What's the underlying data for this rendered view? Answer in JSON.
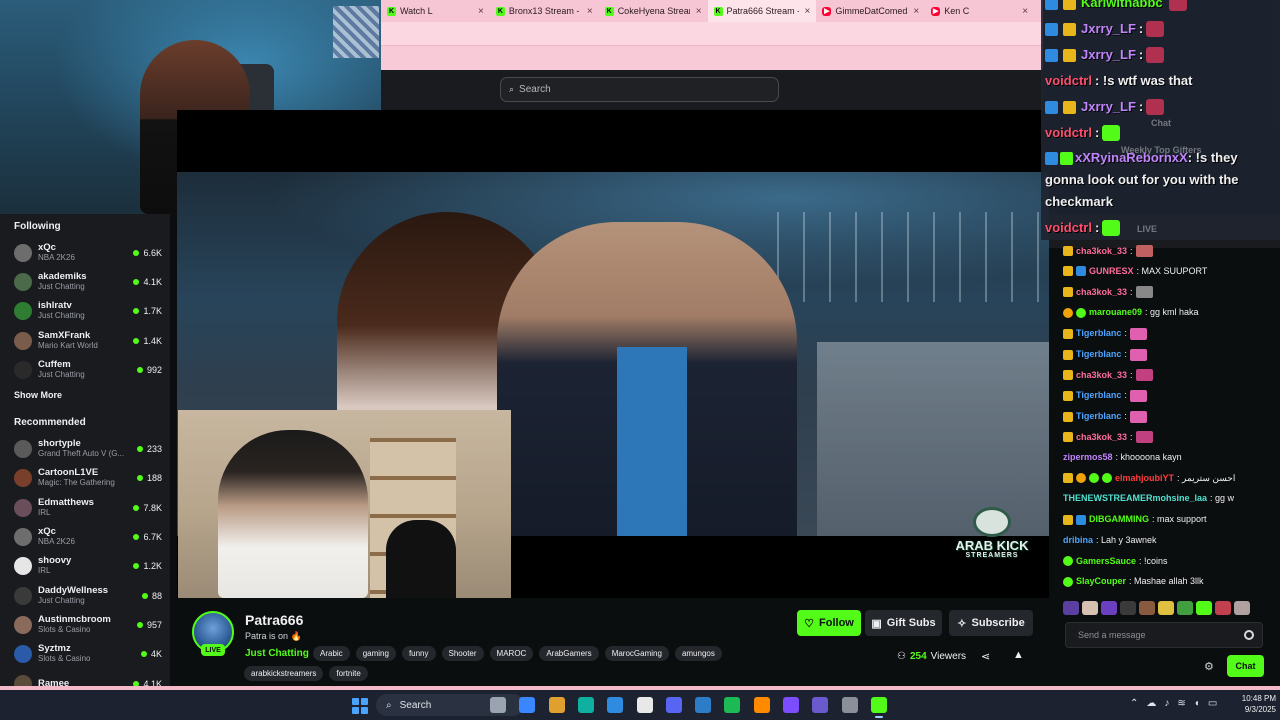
{
  "browser": {
    "tabs": [
      {
        "label": "Watch L",
        "favicon": "K",
        "type": "kick"
      },
      {
        "label": "Bronx13 Stream - Watch Li",
        "favicon": "K",
        "type": "kick"
      },
      {
        "label": "CokeHyena Stream - Watc",
        "favicon": "K",
        "type": "kick"
      },
      {
        "label": "Patra666 Stream - Watch L",
        "favicon": "K",
        "type": "kick",
        "active": true
      },
      {
        "label": "GimmeDatComedy - crazy",
        "favicon": "▶",
        "type": "youtube"
      },
      {
        "label": "Ken C",
        "favicon": "▶",
        "type": "youtube"
      }
    ]
  },
  "top_nav": {
    "search_placeholder": "Search",
    "search_icon": "search-icon"
  },
  "sidebar": {
    "following_header": "Following",
    "following": [
      {
        "name": "xQc",
        "category": "NBA 2K26",
        "viewers": "6.6K",
        "avatar_color": "#6d6d6d"
      },
      {
        "name": "akademiks",
        "category": "Just Chatting",
        "viewers": "4.1K",
        "avatar_color": "#4a6a4a"
      },
      {
        "name": "ishlratv",
        "category": "Just Chatting",
        "viewers": "1.7K",
        "avatar_color": "#2e7d32"
      },
      {
        "name": "SamXFrank",
        "category": "Mario Kart World",
        "viewers": "1.4K",
        "avatar_color": "#7a5c4d"
      },
      {
        "name": "Cuffem",
        "category": "Just Chatting",
        "viewers": "992",
        "avatar_color": "#2a2a2a"
      }
    ],
    "show_more": "Show More",
    "recommended_header": "Recommended",
    "recommended": [
      {
        "name": "shortyple",
        "category": "Grand Theft Auto V (G...",
        "viewers": "233",
        "avatar_color": "#5a5a5a"
      },
      {
        "name": "CartoonL1VE",
        "category": "Magic: The Gathering",
        "viewers": "188",
        "avatar_color": "#7a3f2a"
      },
      {
        "name": "Edmatthews",
        "category": "IRL",
        "viewers": "7.8K",
        "avatar_color": "#6a4f5a"
      },
      {
        "name": "xQc",
        "category": "NBA 2K26",
        "viewers": "6.7K",
        "avatar_color": "#6d6d6d"
      },
      {
        "name": "shoovy",
        "category": "IRL",
        "viewers": "1.2K",
        "avatar_color": "#e6e6e6"
      },
      {
        "name": "DaddyWellness",
        "category": "Just Chatting",
        "viewers": "88",
        "avatar_color": "#3a3a3a"
      },
      {
        "name": "Austinmcbroom",
        "category": "Slots & Casino",
        "viewers": "957",
        "avatar_color": "#8a6a5a"
      },
      {
        "name": "Syztmz",
        "category": "Slots & Casino",
        "viewers": "4K",
        "avatar_color": "#2a5aa8"
      },
      {
        "name": "Ramee",
        "category": "",
        "viewers": "4.1K",
        "avatar_color": "#5a4a3a"
      }
    ]
  },
  "video": {
    "watermark_title": "ARAB KICK",
    "watermark_subtitle": "STREAMERS"
  },
  "stream_info": {
    "channel_name": "Patra666",
    "title": "Patra is on 🔥",
    "live_badge": "LIVE",
    "category": "Just Chatting",
    "tags_row1": [
      "Arabic",
      "gaming",
      "funny",
      "Shooter",
      "MAROC",
      "ArabGamers",
      "MarocGaming",
      "amungos"
    ],
    "tags_row2": [
      "arabkickstreamers",
      "fortnite"
    ],
    "follow_label": "Follow",
    "gift_label": "Gift Subs",
    "subscribe_label": "Subscribe",
    "viewer_count": "254",
    "viewers_label": "Viewers"
  },
  "overlay_chat": {
    "lines": [
      {
        "user": "Karlwithabbc",
        "color": "#53fc18",
        "text": ""
      },
      {
        "user": "Jxrry_LF",
        "color": "#c084fc",
        "text": ":"
      },
      {
        "user": "Jxrry_LF",
        "color": "#c084fc",
        "text": ":"
      },
      {
        "user": "voidctrl",
        "color": "#ff4d6d",
        "text": ": !s wtf was that"
      },
      {
        "user": "Jxrry_LF",
        "color": "#c084fc",
        "text": ":"
      },
      {
        "user": "voidctrl",
        "color": "#ff4d6d",
        "text": ":"
      }
    ],
    "wrap_user": "xXRyinaRebornxX",
    "wrap_text": ": !s they gonna look out for you with the checkmark",
    "last_user": "voidctrl",
    "last_text": ":",
    "faint_chat": "Chat",
    "faint_gifters": "Weekly Top Gifters",
    "faint_live": "LIVE"
  },
  "chat": {
    "messages": [
      {
        "user": "cha3kok_33",
        "color": "#ff6b9a",
        "text": ":",
        "badges": [
          "crown"
        ],
        "emote": "#c06060"
      },
      {
        "user": "GUNRESX",
        "color": "#ff6b9a",
        "text": ": MAX SUUPORT",
        "badges": [
          "crown",
          "sub"
        ]
      },
      {
        "user": "cha3kok_33",
        "color": "#ff6b9a",
        "text": ":",
        "badges": [
          "crown"
        ],
        "emote": "#888888"
      },
      {
        "user": "marouane09",
        "color": "#53fc18",
        "text": ": gg kml haka",
        "badges": [
          "circle",
          "green"
        ]
      },
      {
        "user": "Tigerblanc",
        "color": "#4da3ff",
        "text": ":",
        "badges": [
          "crown"
        ],
        "emote": "#e060b0"
      },
      {
        "user": "Tigerblanc",
        "color": "#4da3ff",
        "text": ":",
        "badges": [
          "crown"
        ],
        "emote": "#e060b0"
      },
      {
        "user": "cha3kok_33",
        "color": "#ff6b9a",
        "text": ":",
        "badges": [
          "crown"
        ],
        "emote": "#c04080"
      },
      {
        "user": "Tigerblanc",
        "color": "#4da3ff",
        "text": ":",
        "badges": [
          "crown"
        ],
        "emote": "#e060b0"
      },
      {
        "user": "Tigerblanc",
        "color": "#4da3ff",
        "text": ":",
        "badges": [
          "crown"
        ],
        "emote": "#e060b0"
      },
      {
        "user": "cha3kok_33",
        "color": "#ff6b9a",
        "text": ":",
        "badges": [
          "crown"
        ],
        "emote": "#c04080"
      },
      {
        "user": "zipermos58",
        "color": "#c084fc",
        "text": ": khoooona kayn",
        "badges": []
      },
      {
        "user": "elmahjoubiYT",
        "color": "#ff3b3b",
        "text": ": احسن ستريمر",
        "badges": [
          "crown",
          "circle",
          "green",
          "green"
        ]
      },
      {
        "user": "THENEWSTREAMERmohsine_laa",
        "color": "#53e0d0",
        "text": ": gg w",
        "badges": []
      },
      {
        "user": "DIBGAMMING",
        "color": "#53fc18",
        "text": ": max support",
        "badges": [
          "crown",
          "sub"
        ]
      },
      {
        "user": "dribina",
        "color": "#4da3ff",
        "text": ": Lah y 3awnek",
        "badges": []
      },
      {
        "user": "GamersSauce",
        "color": "#53fc18",
        "text": ": !coins",
        "badges": [
          "green"
        ]
      },
      {
        "user": "SlayCouper",
        "color": "#53fc18",
        "text": ": Mashae allah 3llk",
        "badges": [
          "green"
        ]
      }
    ],
    "emote_bar_colors": [
      "#5a3fa0",
      "#d8c0b0",
      "#6a40c0",
      "#3a3a3a",
      "#8a5a40",
      "#e0c040",
      "#40a040",
      "#53fc18",
      "#c04050",
      "#b0a0a0"
    ],
    "input_placeholder": "Send a message",
    "chat_button": "Chat"
  },
  "taskbar": {
    "search_label": "Search",
    "time": "10:48 PM",
    "date": "9/3/2025",
    "icon_colors": [
      "#9aa3b0",
      "#3a86ff",
      "#e0a030",
      "#0fb0a0",
      "#2f8be0",
      "#e8e8e8",
      "#5865f2",
      "#2c7cc8",
      "#1db954",
      "#ff8a00",
      "#7c4dff",
      "#6a5acd",
      "#8a8f99",
      "#53fc18"
    ]
  }
}
